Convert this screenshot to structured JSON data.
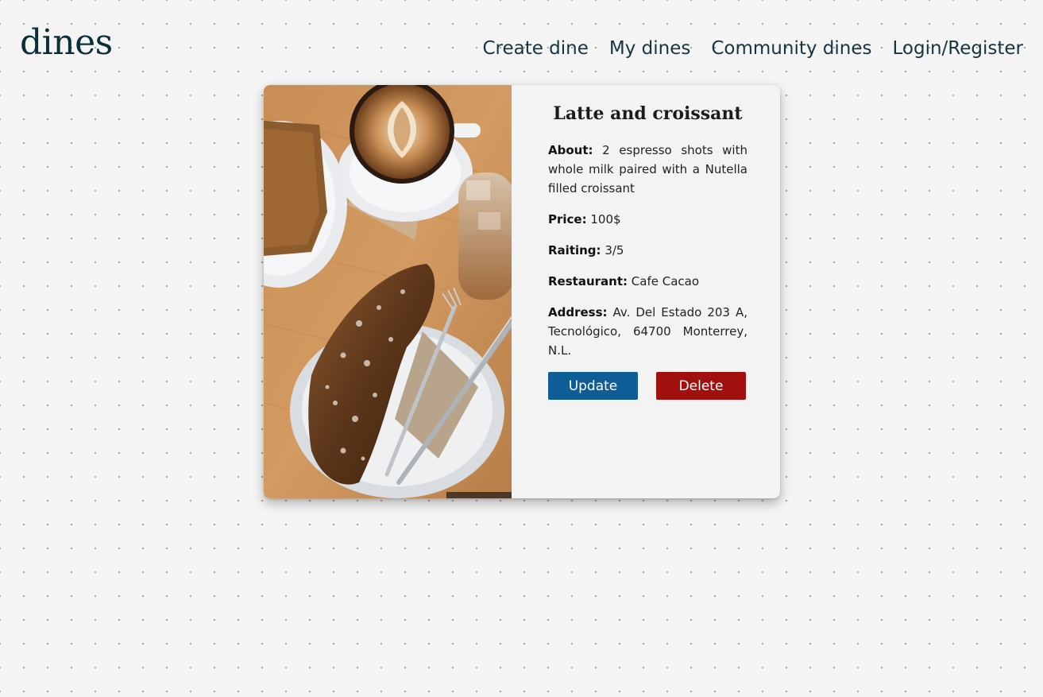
{
  "brand": "dines",
  "nav": {
    "create": "Create dine",
    "my": "My dines",
    "community": "Community dines",
    "login": "Login/Register"
  },
  "dine": {
    "title": "Latte and croissant",
    "about_label": "About:",
    "about": "2 espresso shots with whole milk paired with a Nutella filled croissant",
    "price_label": "Price:",
    "price": "100$",
    "rating_label": "Raiting:",
    "rating": "3/5",
    "restaurant_label": "Restaurant:",
    "restaurant": "Cafe Cacao",
    "address_label": "Address:",
    "address": "Av. Del Estado 203 A, Tecnológico, 64700 Monterrey, N.L."
  },
  "actions": {
    "update": "Update",
    "delete": "Delete"
  },
  "colors": {
    "update": "#0f5d97",
    "delete": "#a10f0f"
  }
}
